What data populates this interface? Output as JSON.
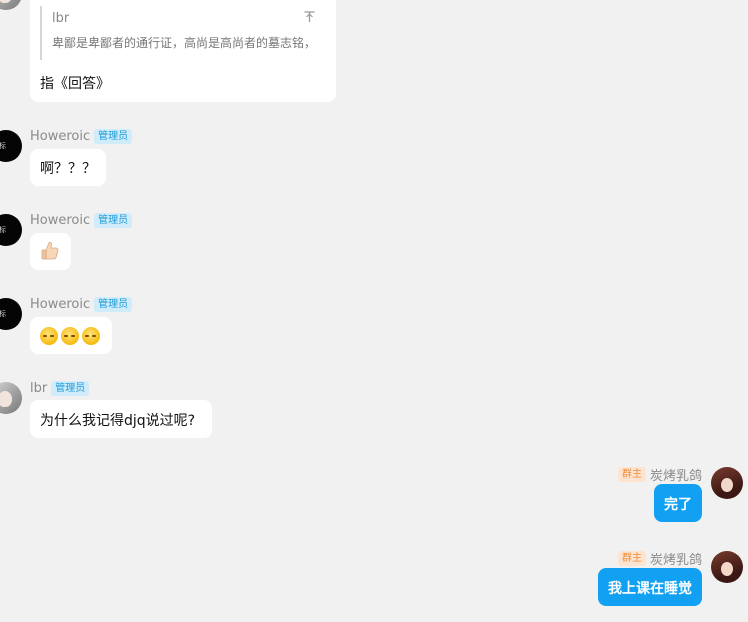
{
  "messages": [
    {
      "quote": {
        "name": "lbr",
        "text": "卑鄙是卑鄙者的通行证，高尚是高尚者的墓志铭，",
        "icon": "pin-icon"
      },
      "text": "指《回答》"
    },
    {
      "sender": "Howeroic",
      "badge": "管理员",
      "text": "啊？？？"
    },
    {
      "sender": "Howeroic",
      "badge": "管理员",
      "emoji": "thumbs-up-icon"
    },
    {
      "sender": "Howeroic",
      "badge": "管理员",
      "emoji": "smiley-face-icon x3"
    },
    {
      "sender": "lbr",
      "badge": "管理员",
      "text": "为什么我记得djq说过呢?"
    },
    {
      "sender": "炭烤乳鸽",
      "badge": "群主",
      "text": "完了"
    },
    {
      "sender": "炭烤乳鸽",
      "badge": "群主",
      "text": "我上课在睡觉"
    }
  ],
  "colors": {
    "background": "#f1f1f1",
    "self_bubble": "#12a1f2",
    "admin_badge": "#1d9bd8",
    "owner_badge": "#f08b3a"
  },
  "avatar_tag": "地标"
}
